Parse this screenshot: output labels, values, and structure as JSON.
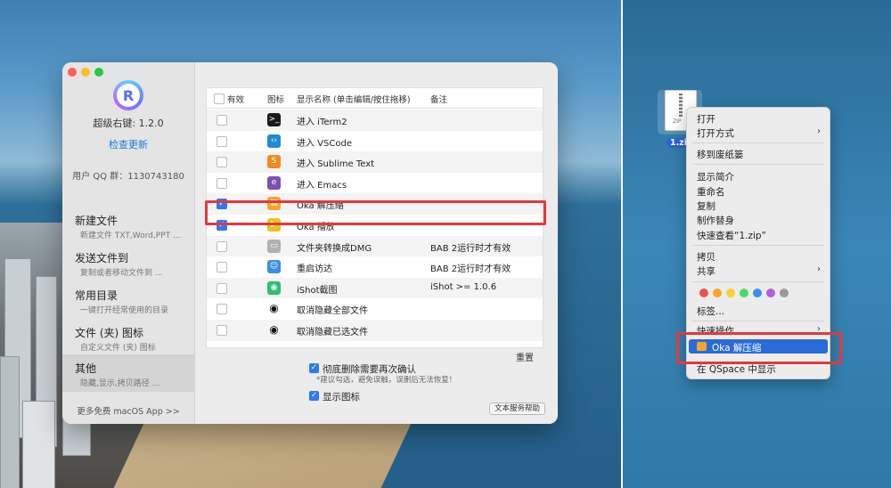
{
  "sidebar": {
    "app_logo_letter": "R",
    "app_name": "超级右键: 1.2.0",
    "check_update": "检查更新",
    "qq_group": "用户 QQ 群：1130743180",
    "sections": [
      {
        "title": "新建文件",
        "sub": "新建文件 TXT,Word,PPT ..."
      },
      {
        "title": "发送文件到",
        "sub": "复制或者移动文件到 ..."
      },
      {
        "title": "常用目录",
        "sub": "一键打开经常使用的目录"
      },
      {
        "title": "文件 (夹) 图标",
        "sub": "自定义文件 (夹) 图标"
      },
      {
        "title": "其他",
        "sub": "隐藏,显示,拷贝路径 ..."
      }
    ],
    "active_section": "其他",
    "more_apps": "更多免费 macOS App >>"
  },
  "table": {
    "headers": {
      "enabled": "有效",
      "icon": "图标",
      "name": "显示名称 (单击编辑/按住拖移)",
      "note": "备注"
    },
    "rows": [
      {
        "checked": false,
        "icon": "iterm-icon",
        "name": "进入 iTerm2",
        "note": "",
        "color": "#1a1a1a"
      },
      {
        "checked": false,
        "icon": "vscode-icon",
        "name": "进入 VSCode",
        "note": "",
        "color": "#1f8ad2"
      },
      {
        "checked": false,
        "icon": "sublime-icon",
        "name": "进入 Sublime Text",
        "note": "",
        "color": "#f28b1e"
      },
      {
        "checked": false,
        "icon": "emacs-icon",
        "name": "进入 Emacs",
        "note": "",
        "color": "#7b4fb6"
      },
      {
        "checked": true,
        "icon": "oka-unzip-icon",
        "name": "Oka 解压缩",
        "note": "",
        "color": "#f2a72b"
      },
      {
        "checked": true,
        "icon": "oka-player-icon",
        "name": "Oka 播放",
        "note": "",
        "color": "#f0c020"
      },
      {
        "checked": false,
        "icon": "dmg-icon",
        "name": "文件夹转换成DMG",
        "note": "BAB 2运行时才有效",
        "color": "#b0b0b0"
      },
      {
        "checked": false,
        "icon": "finder-icon",
        "name": "重启访达",
        "note": "BAB 2运行时才有效",
        "color": "#3d8ce8"
      },
      {
        "checked": false,
        "icon": "ishot-icon",
        "name": "iShot截图",
        "note": "iShot >= 1.0.6",
        "color": "#2fbf73"
      },
      {
        "checked": false,
        "icon": "eye-icon",
        "name": "取消隐藏全部文件",
        "note": "",
        "color": "#111111"
      },
      {
        "checked": false,
        "icon": "eye-icon",
        "name": "取消隐藏已选文件",
        "note": "",
        "color": "#111111"
      }
    ]
  },
  "reset_label": "重置",
  "options": {
    "delete_confirm_label": "彻底删除需要再次确认",
    "delete_confirm_hint": "*建议勾选，避免误触，误删后无法恢复！",
    "show_icons_label": "显示图标"
  },
  "help_button": "文本服务帮助",
  "zip_file": {
    "name": "1.zip",
    "tag": "ZIP"
  },
  "context_menu": {
    "open": "打开",
    "open_with": "打开方式",
    "move_to_trash": "移到废纸篓",
    "get_info": "显示简介",
    "rename": "重命名",
    "duplicate": "复制",
    "make_alias": "制作替身",
    "quick_look": "快速查看“1.zip”",
    "copy": "拷贝",
    "share": "共享",
    "tag_colors": [
      "#ef5350",
      "#f5a623",
      "#f8d22e",
      "#4cd964",
      "#3b8df0",
      "#b05fd6",
      "#9a9a9a"
    ],
    "tags": "标签...",
    "quick_actions": "快速操作",
    "oka_unzip": "Oka 解压缩",
    "show_in_qspace": "在 QSpace 中显示"
  }
}
